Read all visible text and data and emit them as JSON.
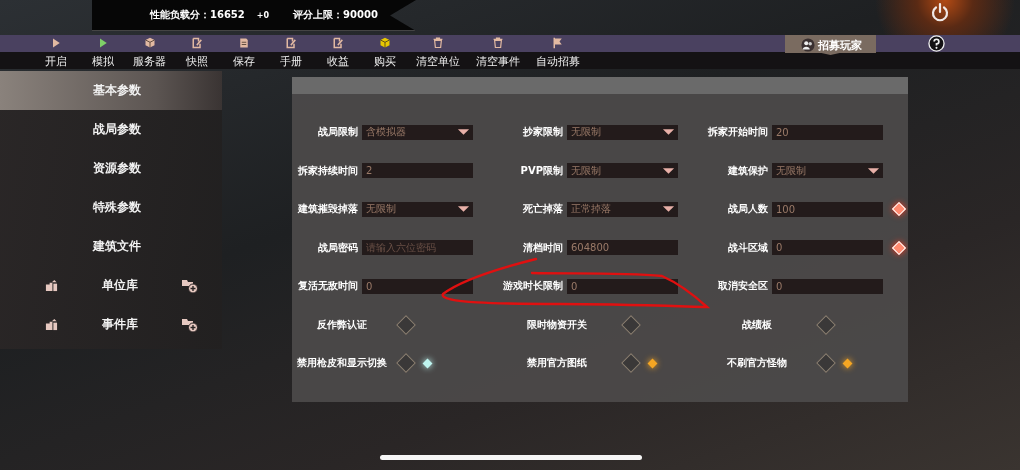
{
  "header": {
    "score": "性能负载分：16652",
    "delta": "+0",
    "limit": "评分上限：90000"
  },
  "toolbar": [
    {
      "label": "开启",
      "kind": "play",
      "color": "#e2b9a2"
    },
    {
      "label": "模拟",
      "kind": "play",
      "color": "#7fd068"
    },
    {
      "label": "服务器",
      "kind": "box",
      "color": "#e2b9a2"
    },
    {
      "label": "快照",
      "kind": "edit",
      "color": "#e2b9a2"
    },
    {
      "label": "保存",
      "kind": "doc",
      "color": "#e2b9a2"
    },
    {
      "label": "手册",
      "kind": "edit",
      "color": "#e2b9a2"
    },
    {
      "label": "收益",
      "kind": "edit",
      "color": "#e2b9a2"
    },
    {
      "label": "购买",
      "kind": "box",
      "color": "#e8c800"
    },
    {
      "label": "清空单位",
      "kind": "trash",
      "color": "#e2b9a2"
    },
    {
      "label": "清空事件",
      "kind": "trash",
      "color": "#e2b9a2"
    },
    {
      "label": "自动招募",
      "kind": "flag",
      "color": "#e2b9a2"
    }
  ],
  "recruit_button": {
    "label": "招募玩家"
  },
  "sidebar": {
    "items": [
      {
        "label": "基本参数",
        "selected": true
      },
      {
        "label": "战局参数",
        "selected": false
      },
      {
        "label": "资源参数",
        "selected": false
      },
      {
        "label": "特殊参数",
        "selected": false
      },
      {
        "label": "建筑文件",
        "selected": false
      }
    ],
    "libraries": [
      {
        "label": "单位库"
      },
      {
        "label": "事件库"
      }
    ]
  },
  "form": {
    "fields": [
      {
        "label": "战局限制",
        "kind": "dropdown",
        "value": "含模拟器"
      },
      {
        "label": "抄家限制",
        "kind": "dropdown",
        "value": "无限制"
      },
      {
        "label": "拆家开始时间",
        "kind": "input",
        "value": "20"
      },
      {
        "label": "拆家持续时间",
        "kind": "input",
        "value": "2"
      },
      {
        "label": "PVP限制",
        "kind": "dropdown",
        "value": "无限制"
      },
      {
        "label": "建筑保护",
        "kind": "dropdown",
        "value": "无限制"
      },
      {
        "label": "建筑摧毁掉落",
        "kind": "dropdown",
        "value": "无限制"
      },
      {
        "label": "死亡掉落",
        "kind": "dropdown",
        "value": "正常掉落"
      },
      {
        "label": "战局人数",
        "kind": "input",
        "value": "100",
        "marker": true
      },
      {
        "label": "战局密码",
        "kind": "input",
        "placeholder": "请输入六位密码"
      },
      {
        "label": "清档时间",
        "kind": "input",
        "value": "604800"
      },
      {
        "label": "战斗区域",
        "kind": "input",
        "value": "0",
        "marker": true
      },
      {
        "label": "复活无敌时间",
        "kind": "input",
        "value": "0"
      },
      {
        "label": "游戏时长限制",
        "kind": "input",
        "value": "0"
      },
      {
        "label": "取消安全区",
        "kind": "input",
        "value": "0"
      }
    ],
    "toggles": [
      {
        "label": "反作弊认证",
        "checked": false
      },
      {
        "label": "限时物资开关",
        "checked": false
      },
      {
        "label": "战绩板",
        "checked": false
      },
      {
        "label": "禁用枪皮和显示切换",
        "checked": false,
        "color": "#bff5f0"
      },
      {
        "label": "禁用官方图纸",
        "checked": false,
        "color": "#f5a623"
      },
      {
        "label": "不刷官方怪物",
        "checked": false,
        "color": "#f5a623"
      }
    ]
  }
}
